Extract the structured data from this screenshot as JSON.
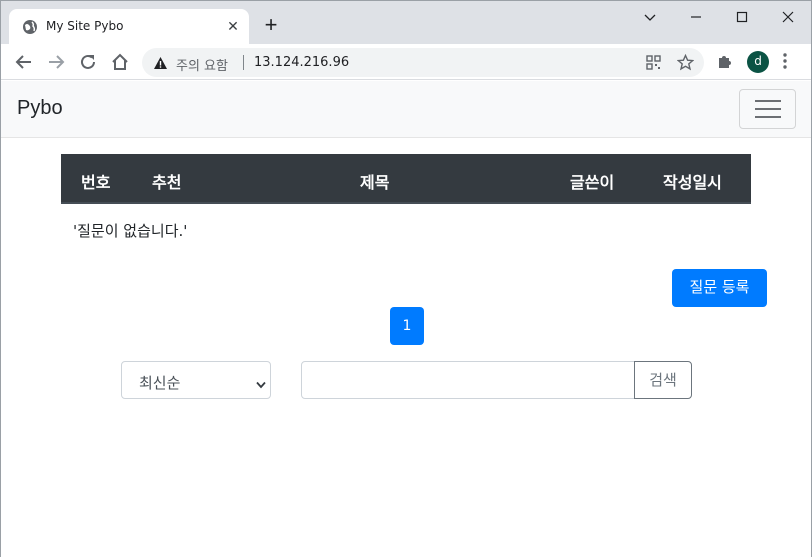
{
  "browser": {
    "tab_title": "My Site Pybo",
    "security_label": "주의 요함",
    "url": "13.124.216.96",
    "profile_initial": "d"
  },
  "icons": {
    "tab_favicon": "globe-icon",
    "tab_close": "close-icon",
    "new_tab": "plus-icon",
    "back": "arrow-left-icon",
    "forward": "arrow-right-icon",
    "reload": "reload-icon",
    "home": "home-icon",
    "security": "warning-icon",
    "qr": "qr-code-icon",
    "bookmark": "star-icon",
    "extensions": "puzzle-icon",
    "menu": "more-vertical-icon",
    "navbar_toggler": "hamburger-icon",
    "select_arrow": "chevron-down-icon"
  },
  "navbar": {
    "brand": "Pybo"
  },
  "table": {
    "headers": [
      "번호",
      "추천",
      "제목",
      "글쓴이",
      "작성일시"
    ],
    "empty_message": "'질문이 없습니다.'"
  },
  "actions": {
    "create_label": "질문 등록"
  },
  "pagination": {
    "pages": [
      "1"
    ],
    "current": "1"
  },
  "search": {
    "sort_selected": "최신순",
    "query": "",
    "button_label": "검색"
  },
  "colors": {
    "primary": "#007bff",
    "table_header_bg": "#343a40",
    "navbar_bg": "#f8f9fa",
    "tabstrip_bg": "#dee1e6"
  }
}
